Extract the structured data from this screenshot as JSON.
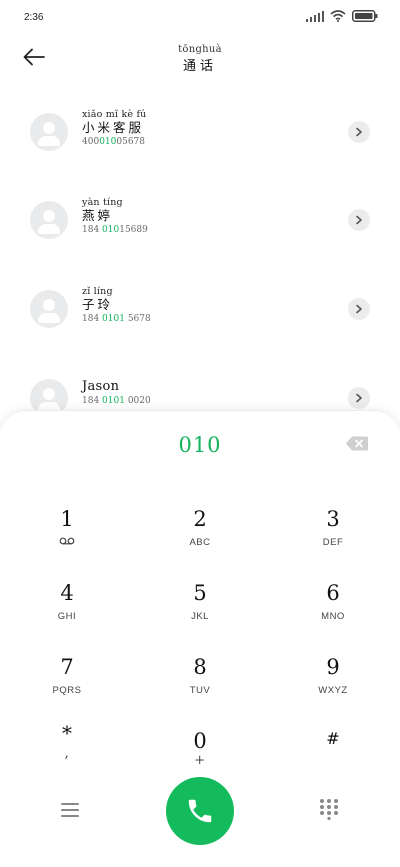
{
  "status": {
    "time": "2:36"
  },
  "header": {
    "title_pinyin": "tōnghuà",
    "title": "通话"
  },
  "results": [
    {
      "name_pinyin": "xiǎo mǐ  kè  fú",
      "name": "小米客服",
      "number_pre": "400",
      "number_hl": "010",
      "number_post": "05678"
    },
    {
      "name_pinyin": "yàn tíng",
      "name": "燕婷",
      "number_pre": "184 ",
      "number_hl": "010",
      "number_post": "15689"
    },
    {
      "name_pinyin": "zǐ  líng",
      "name": "子玲",
      "number_pre": "184 ",
      "number_hl": "0101",
      "number_post": " 5678"
    },
    {
      "name_latin": "Jason",
      "number_pre": "184 ",
      "number_hl": "0101",
      "number_post": " 0020"
    }
  ],
  "dialpad": {
    "input": "010",
    "keys": [
      {
        "digit": "1",
        "letters": ""
      },
      {
        "digit": "2",
        "letters": "ABC"
      },
      {
        "digit": "3",
        "letters": "DEF"
      },
      {
        "digit": "4",
        "letters": "GHI"
      },
      {
        "digit": "5",
        "letters": "JKL"
      },
      {
        "digit": "6",
        "letters": "MNO"
      },
      {
        "digit": "7",
        "letters": "PQRS"
      },
      {
        "digit": "8",
        "letters": "TUV"
      },
      {
        "digit": "9",
        "letters": "WXYZ"
      },
      {
        "digit": "*",
        "letters": ","
      },
      {
        "digit": "0",
        "letters": "+"
      },
      {
        "digit": "#",
        "letters": ""
      }
    ]
  },
  "icons": {
    "back": "arrow-left-icon",
    "chevron": "chevron-right-icon",
    "backspace": "backspace-icon",
    "voicemail": "voicemail-icon",
    "menu": "menu-icon",
    "call": "phone-icon",
    "grid": "dialpad-grid-icon"
  },
  "colors": {
    "accent": "#13b35a",
    "call_button": "#14bb5c"
  }
}
